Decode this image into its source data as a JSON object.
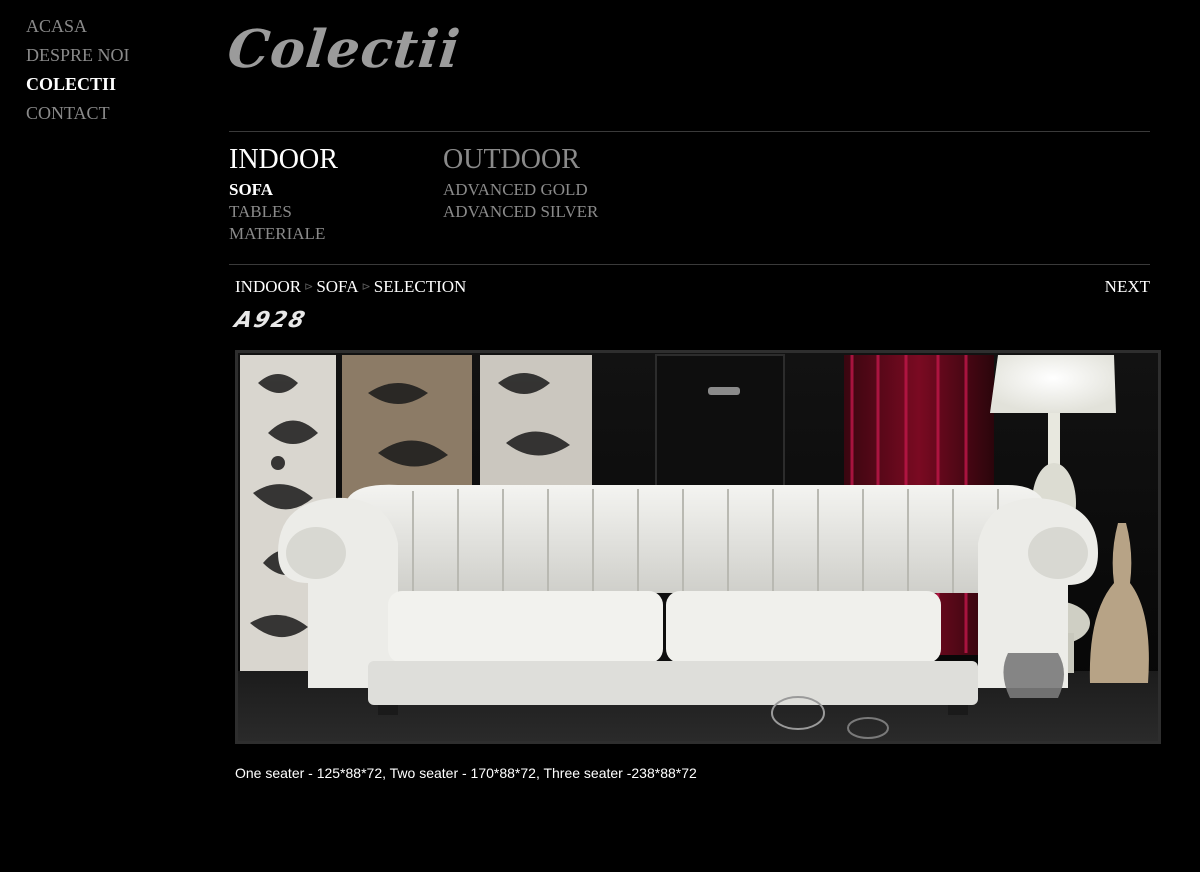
{
  "nav": {
    "items": [
      {
        "label": "ACASA",
        "active": false
      },
      {
        "label": "DESPRE NOI",
        "active": false
      },
      {
        "label": "COLECTII",
        "active": true
      },
      {
        "label": "CONTACT",
        "active": false
      }
    ]
  },
  "logo": {
    "text": "Colectii"
  },
  "categories": {
    "indoor": {
      "heading": "INDOOR",
      "items": [
        "SOFA",
        "TABLES",
        "MATERIALE"
      ],
      "active_item": "SOFA"
    },
    "outdoor": {
      "heading": "OUTDOOR",
      "items": [
        "ADVANCED GOLD",
        "ADVANCED SILVER"
      ]
    }
  },
  "breadcrumb": {
    "items": [
      "INDOOR",
      "SOFA",
      "SELECTION"
    ],
    "separator": "⊳"
  },
  "next_label": "NEXT",
  "product": {
    "code": "A928",
    "image_subject": "white-chesterfield-sofa",
    "caption": "One seater - 125*88*72, Two seater - 170*88*72, Three seater -238*88*72"
  },
  "colors": {
    "background": "#000000",
    "active_text": "#ffffff",
    "inactive_text": "#8a8a8a",
    "divider": "#3a3a3a"
  }
}
